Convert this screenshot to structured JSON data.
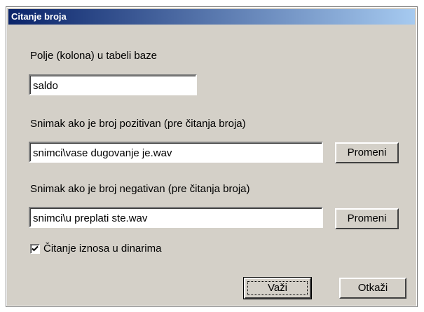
{
  "window": {
    "title": "Citanje broja"
  },
  "field_section": {
    "label": "Polje (kolona) u tabeli baze",
    "value": "saldo"
  },
  "positive_section": {
    "label": "Snimak ako je broj pozitivan (pre čitanja broja)",
    "value": "snimci\\vase dugovanje je.wav",
    "button_label": "Promeni"
  },
  "negative_section": {
    "label": "Snimak ako je broj negativan (pre čitanja broja)",
    "value": "snimci\\u preplati ste.wav",
    "button_label": "Promeni"
  },
  "currency_checkbox": {
    "label": "Čitanje iznosa u dinarima",
    "checked": true
  },
  "footer": {
    "ok_label": "Važi",
    "cancel_label": "Otkaži"
  },
  "icons": {
    "checkbox_mark": "check-mark-icon"
  }
}
